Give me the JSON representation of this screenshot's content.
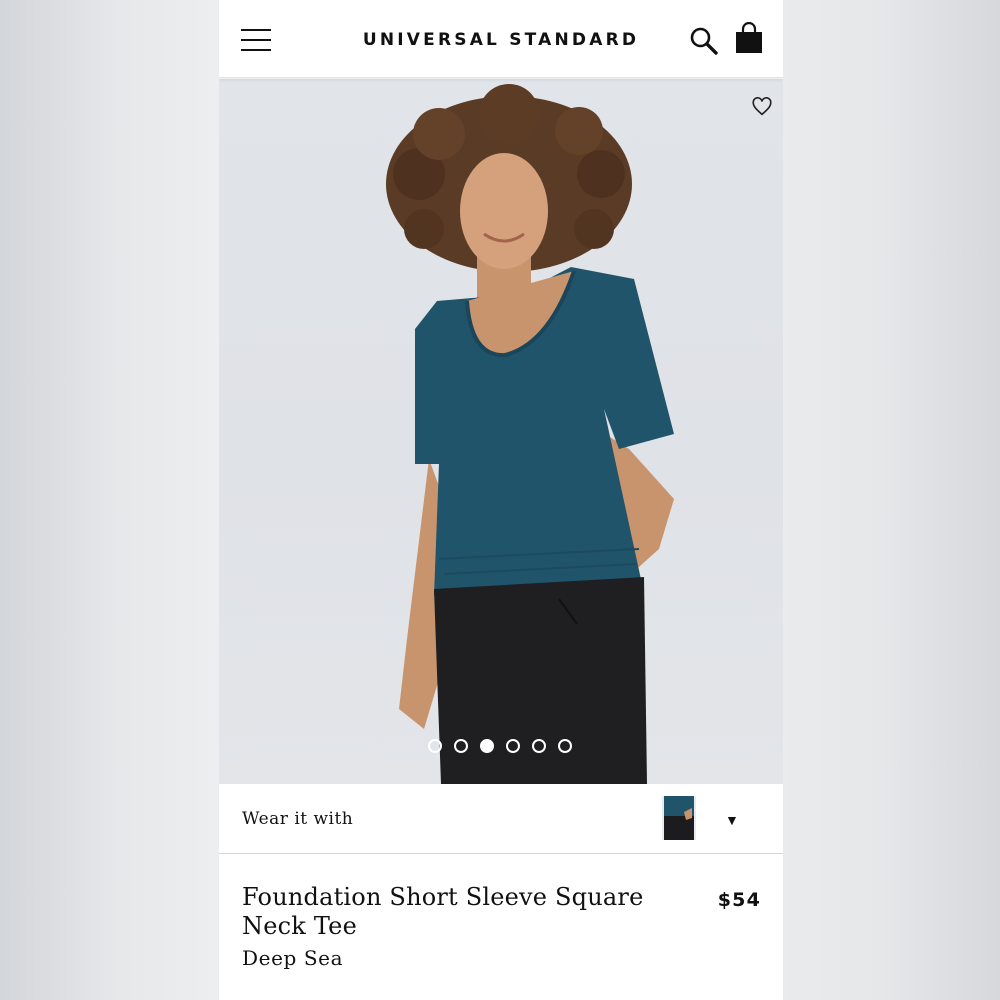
{
  "header": {
    "brand": "UNIVERSAL STANDARD",
    "menu_icon": "menu-icon",
    "search_icon": "search-icon",
    "bag_icon": "shopping-bag-icon"
  },
  "gallery": {
    "wishlist_icon": "heart-outline-icon",
    "slide_count": 6,
    "active_slide": 3,
    "shirt_color": "#20546a"
  },
  "wear_it_with": {
    "label": "Wear it with",
    "caret_icon": "triangle-down-icon"
  },
  "product": {
    "title": "Foundation Short Sleeve Square Neck Tee",
    "color": "Deep Sea",
    "price": "$54"
  }
}
